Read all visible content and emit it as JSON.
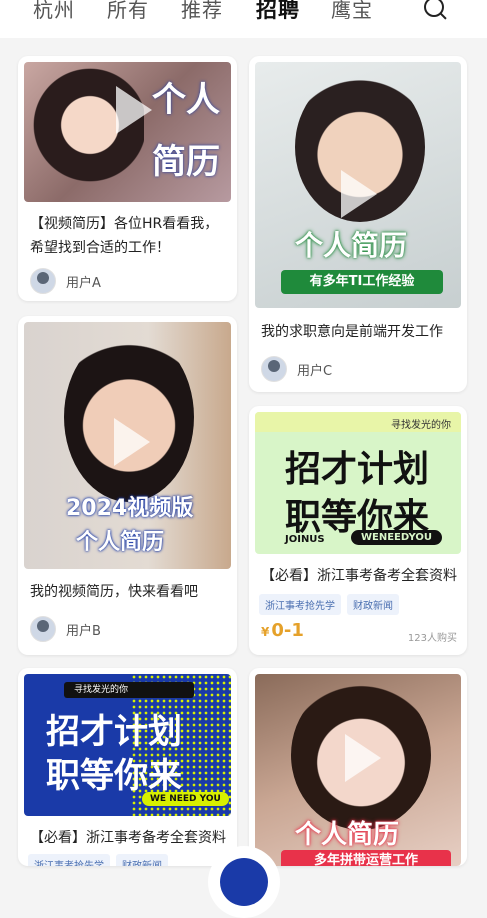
{
  "tabs": [
    "杭州",
    "所有",
    "推荐",
    "招聘",
    "鹰宝"
  ],
  "active_tab": "招聘",
  "cards": [
    {
      "thumb_line1": "个人",
      "thumb_line2": "简历",
      "title": "【视频简历】各位HR看看我，希望找到合适的工作！",
      "user": "用户A"
    },
    {
      "thumb_line1": "个人简历",
      "thumb_line2": "有多年TI工作经验",
      "title": "我的求职意向是前端开发工作",
      "user": "用户C"
    },
    {
      "thumb_line1": "2024视频版",
      "thumb_line2": "个人简历",
      "title": "我的视频简历，快来看看吧",
      "user": "用户B"
    },
    {
      "thumb_small": "寻找发光的你",
      "thumb_line1": "招才计划",
      "thumb_line2": "职等你来",
      "thumb_left": "JOINUS",
      "thumb_right": "WENEEDYOU",
      "title": "【必看】浙江事考备考全套资料",
      "tags": [
        "浙江事考抢先学",
        "财政新闻"
      ],
      "price_symbol": "¥",
      "price": "0-1",
      "bought": "123人购买"
    },
    {
      "thumb_small": "寻找发光的你",
      "thumb_line1": "招才计划",
      "thumb_line2": "职等你来",
      "thumb_right": "WE NEED YOU",
      "title": "【必看】浙江事考备考全套资料",
      "tags": [
        "浙江事考抢先学",
        "财政新闻"
      ]
    },
    {
      "thumb_line1": "个人简历",
      "thumb_line2": "多年拼带运营工作"
    }
  ],
  "colors": {
    "accent": "#1a3aa8",
    "price": "#e5a12a",
    "green": "#1f8a3b"
  }
}
